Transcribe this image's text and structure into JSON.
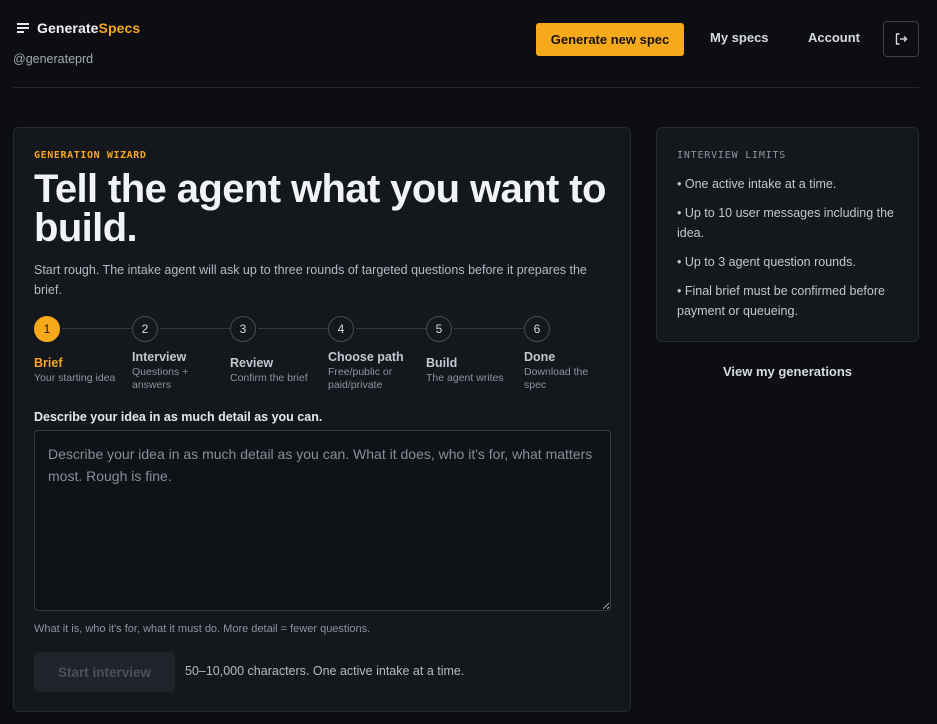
{
  "header": {
    "brand_part1": "Generate",
    "brand_part2": "Specs",
    "handle": "@generateprd",
    "primary_cta": "Generate new spec",
    "nav": {
      "my_specs": "My specs",
      "account": "Account"
    },
    "logout_icon": "logout-icon"
  },
  "wizard": {
    "eyebrow": "GENERATION WIZARD",
    "title": "Tell the agent what you want to build.",
    "subtitle": "Start rough. The intake agent will ask up to three rounds of targeted questions before it prepares the brief.",
    "steps": [
      {
        "num": "1",
        "name": "Brief",
        "desc": "Your starting idea",
        "active": true
      },
      {
        "num": "2",
        "name": "Interview",
        "desc": "Questions + answers"
      },
      {
        "num": "3",
        "name": "Review",
        "desc": "Confirm the brief"
      },
      {
        "num": "4",
        "name": "Choose path",
        "desc": "Free/public or paid/private"
      },
      {
        "num": "5",
        "name": "Build",
        "desc": "The agent writes"
      },
      {
        "num": "6",
        "name": "Done",
        "desc": "Download the spec"
      }
    ],
    "field_label": "Describe your idea in as much detail as you can.",
    "placeholder": "Describe your idea in as much detail as you can. What it does, who it's for, what matters most. Rough is fine.",
    "helper": "What it is, who it's for, what it must do. More detail = fewer questions.",
    "start_button": "Start interview",
    "char_note": "50–10,000 characters. One active intake at a time."
  },
  "limits": {
    "title": "INTERVIEW LIMITS",
    "items": [
      "• One active intake at a time.",
      "• Up to 10 user messages including the idea.",
      "• Up to 3 agent question rounds.",
      "• Final brief must be confirmed before payment or queueing."
    ],
    "view_link": "View my generations"
  },
  "colors": {
    "accent": "#f7a91c",
    "background": "#0c0e12",
    "card": "#14171c"
  }
}
